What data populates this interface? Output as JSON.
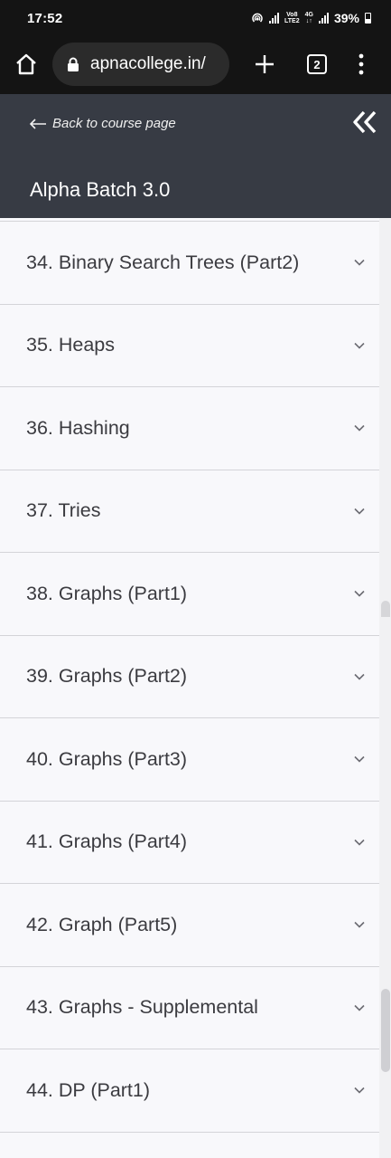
{
  "status_bar": {
    "time": "17:52",
    "carrier_top": "Vo8",
    "carrier_bottom": "LTE2",
    "network_top": "4G",
    "network_bottom": "↓↑",
    "battery": "39%"
  },
  "browser": {
    "url": "apnacollege.in/",
    "tab_count": "2",
    "icons": [
      "home-icon",
      "lock-icon",
      "plus-icon",
      "tabs-icon",
      "more-vert-icon"
    ]
  },
  "course_header": {
    "back_label": "Back to course page",
    "title": "Alpha Batch 3.0",
    "icons": [
      "arrow-left-icon",
      "double-chevron-left-icon"
    ]
  },
  "modules": [
    {
      "label": "34. Binary Search Trees (Part2)"
    },
    {
      "label": "35. Heaps"
    },
    {
      "label": "36. Hashing"
    },
    {
      "label": "37. Tries"
    },
    {
      "label": "38. Graphs (Part1)"
    },
    {
      "label": "39. Graphs (Part2)"
    },
    {
      "label": "40. Graphs (Part3)"
    },
    {
      "label": "41. Graphs (Part4)"
    },
    {
      "label": "42. Graph (Part5)"
    },
    {
      "label": "43. Graphs - Supplemental"
    },
    {
      "label": "44. DP (Part1)"
    }
  ],
  "colors": {
    "status_bg": "#141414",
    "header_bg": "#373b44",
    "list_bg": "#f8f8fb",
    "divider": "#d4d4d8",
    "text": "#3b3b40"
  }
}
